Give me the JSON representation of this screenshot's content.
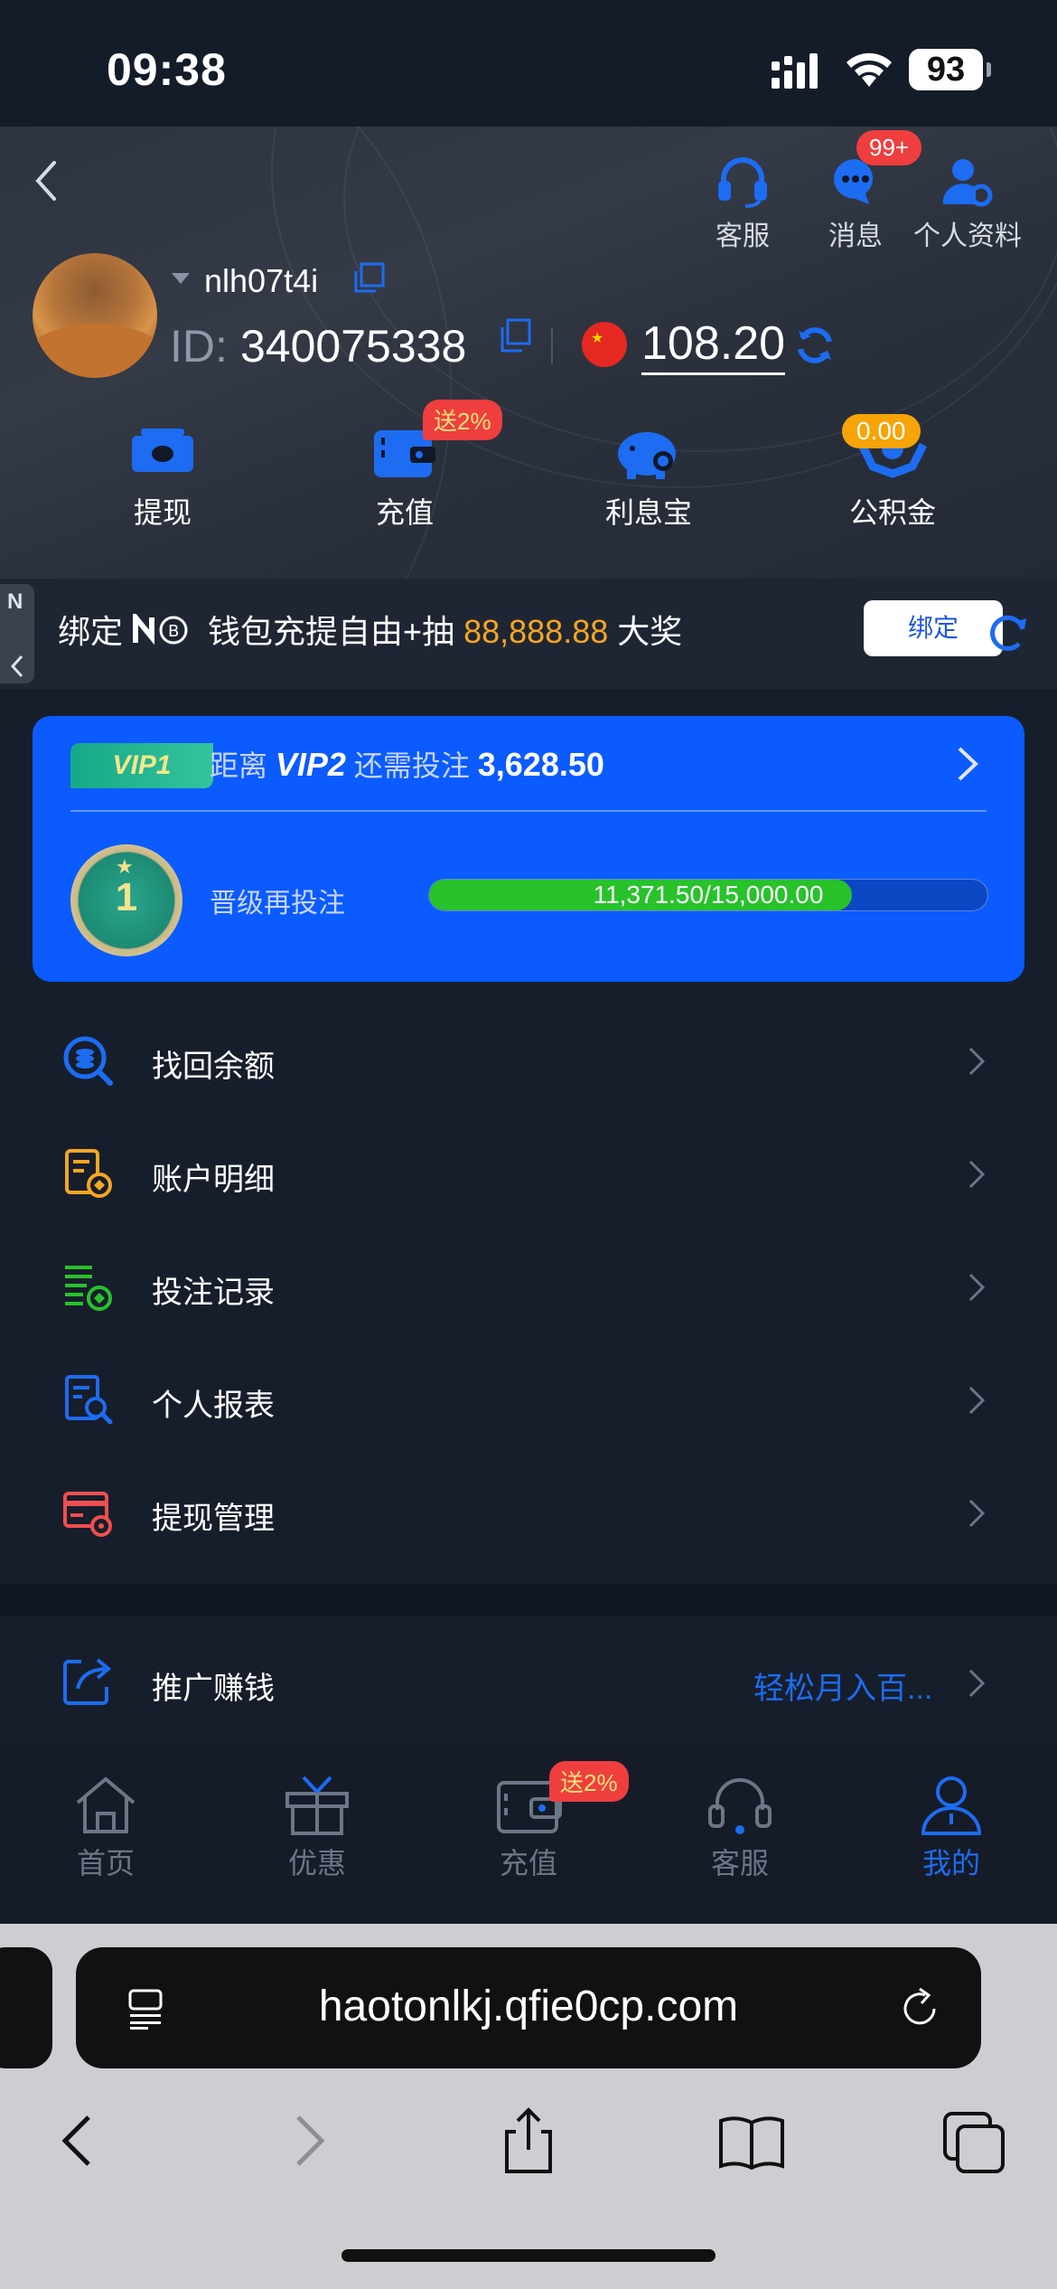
{
  "status": {
    "time": "09:38",
    "battery": "93"
  },
  "header": {
    "service_label": "客服",
    "messages_label": "消息",
    "messages_badge": "99+",
    "profile_label": "个人资料",
    "username": "nlh07t4i",
    "id_label": "ID:",
    "id_value": "340075338",
    "balance": "108.20"
  },
  "quick_actions": [
    {
      "label": "提现"
    },
    {
      "label": "充值",
      "tag": "送2%"
    },
    {
      "label": "利息宝"
    },
    {
      "label": "公积金",
      "tag": "0.00"
    }
  ],
  "bind": {
    "text_prefix": "绑定",
    "text_mid": "钱包充提自由+抽",
    "amount": "88,888.88",
    "text_suffix": "大奖",
    "button": "绑定",
    "side_tab": "N"
  },
  "vip": {
    "current": "VIP1",
    "distance_label": "距离",
    "next": "VIP2",
    "need_label": "还需投注",
    "need_value": "3,628.50",
    "level_number": "1",
    "upgrade_label": "晋级再投注",
    "progress_text": "11,371.50/15,000.00",
    "progress_fraction": 0.758
  },
  "menu": [
    {
      "label": "找回余额"
    },
    {
      "label": "账户明细"
    },
    {
      "label": "投注记录"
    },
    {
      "label": "个人报表"
    },
    {
      "label": "提现管理"
    }
  ],
  "promo": {
    "label": "推广赚钱",
    "sub": "轻松月入百..."
  },
  "tabbar": [
    {
      "label": "首页"
    },
    {
      "label": "优惠"
    },
    {
      "label": "充值",
      "tag": "送2%"
    },
    {
      "label": "客服"
    },
    {
      "label": "我的"
    }
  ],
  "browser": {
    "url": "haotonlkj.qfie0cp.com"
  },
  "colors": {
    "accent": "#1d6cf2",
    "vip_card": "#0b5bff",
    "gold": "#f5a623",
    "badge": "#ef3e3e"
  }
}
